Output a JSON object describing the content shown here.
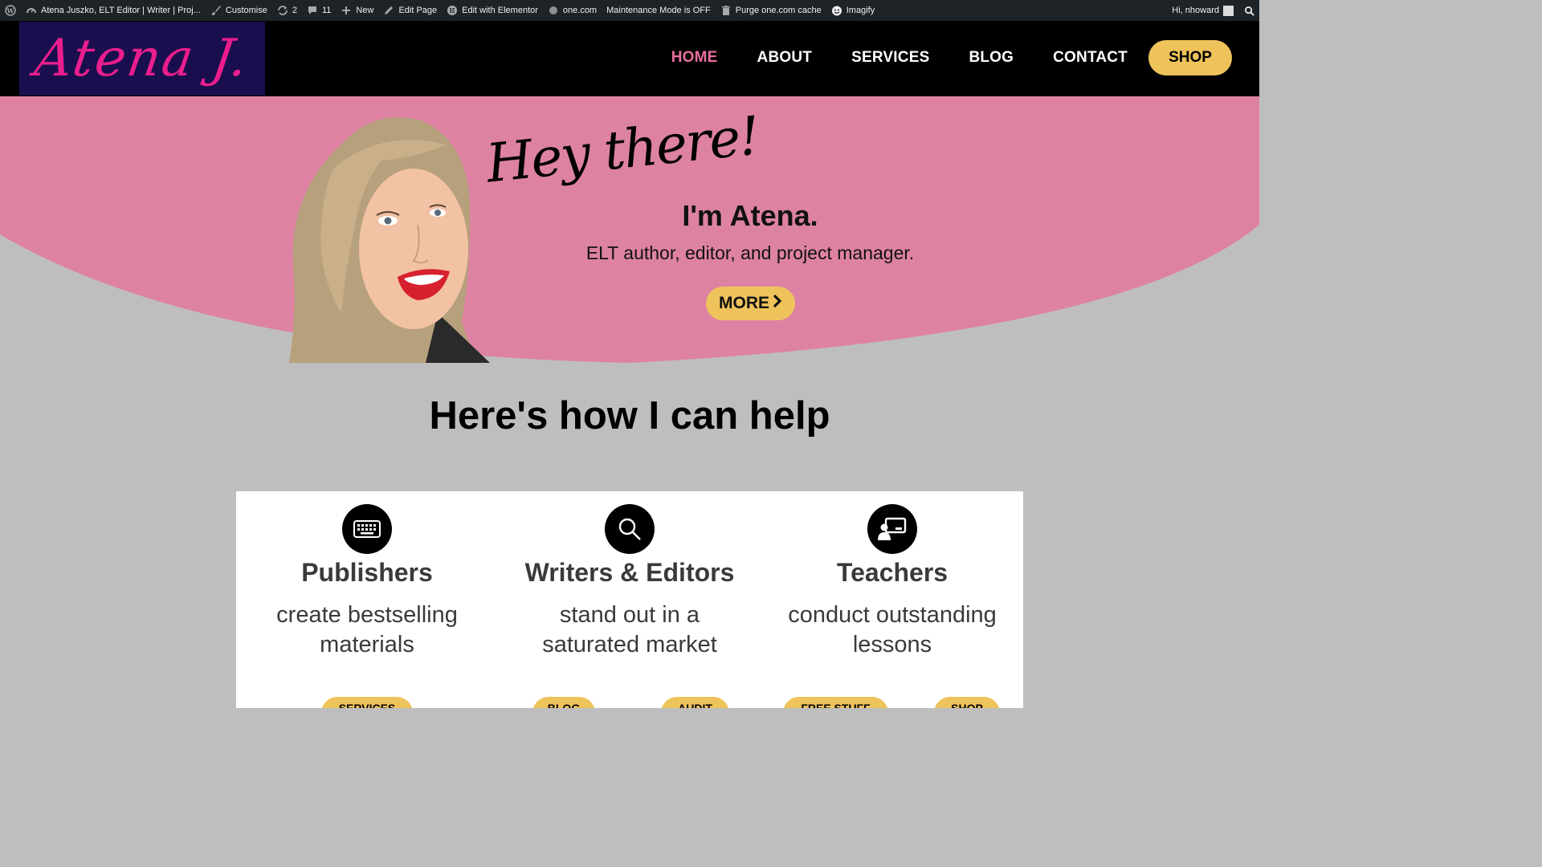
{
  "adminbar": {
    "site_title": "Atena Juszko, ELT Editor | Writer | Proj...",
    "customise": "Customise",
    "updates": "2",
    "comments": "11",
    "new": "New",
    "edit_page": "Edit Page",
    "elementor": "Edit with Elementor",
    "onecom": "one.com",
    "maintenance": "Maintenance Mode is OFF",
    "purge": "Purge one.com cache",
    "imagify": "Imagify",
    "greeting": "Hi, nhoward"
  },
  "header": {
    "logo": "Atena J.",
    "nav": [
      "HOME",
      "ABOUT",
      "SERVICES",
      "BLOG",
      "CONTACT"
    ],
    "shop": "SHOP"
  },
  "hero": {
    "script_greeting": "Hey there!",
    "name": "I'm Atena.",
    "tagline": "ELT author, editor, and project manager.",
    "more": "MORE"
  },
  "help": {
    "title": "Here's how I can help",
    "cards": [
      {
        "title": "Publishers",
        "line1": "create bestselling",
        "line2": "materials",
        "buttons": [
          "SERVICES"
        ]
      },
      {
        "title": "Writers & Editors",
        "line1": "stand out in a",
        "line2": "saturated market",
        "buttons": [
          "BLOG",
          "AUDIT"
        ]
      },
      {
        "title": "Teachers",
        "line1": "conduct outstanding",
        "line2": "lessons",
        "buttons": [
          "FREE STUFF",
          "SHOP"
        ]
      }
    ]
  },
  "colors": {
    "hero_pink": "#de82a4",
    "gray_bg": "#bebebe",
    "accent_yellow": "#efc35c",
    "active_nav": "#e96f9f",
    "logo_bg": "#1a0f4e",
    "logo_text": "#ea1e8c"
  }
}
